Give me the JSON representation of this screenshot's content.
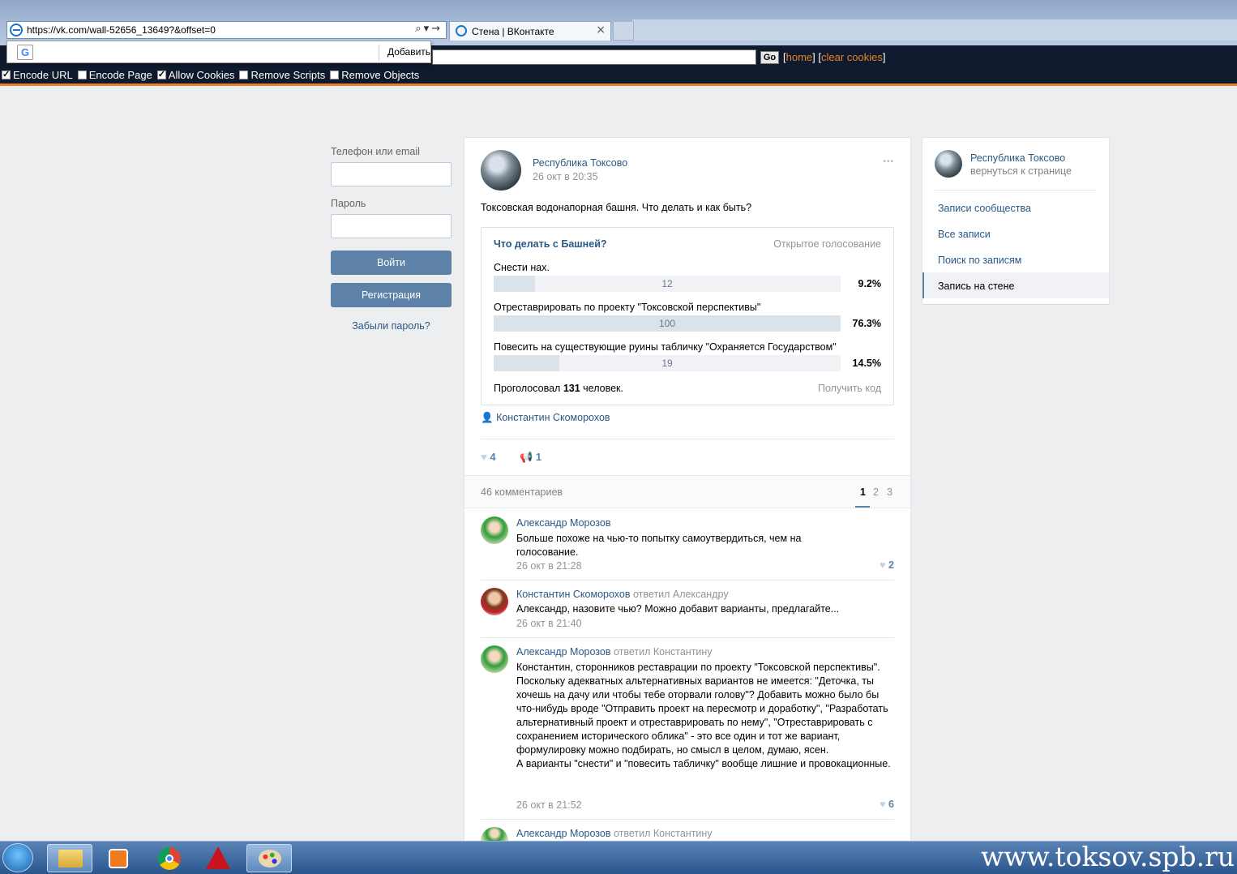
{
  "browser": {
    "url": "https://vk.com/wall-52656_13649?&offset=0",
    "tab_title": "Стена | ВКонтакте",
    "tab_close": "×",
    "dropdown_add": "Добавить",
    "google_glyph": "G"
  },
  "proxy": {
    "go_label": "Go",
    "home_link": "home",
    "clear_cookies_link": "clear cookies",
    "options": [
      {
        "label": "Encode URL",
        "checked": true
      },
      {
        "label": "Encode Page",
        "checked": false
      },
      {
        "label": "Allow Cookies",
        "checked": true
      },
      {
        "label": "Remove Scripts",
        "checked": false
      },
      {
        "label": "Remove Objects",
        "checked": false
      }
    ]
  },
  "login": {
    "phone_label": "Телефон или email",
    "password_label": "Пароль",
    "login_button": "Войти",
    "register_button": "Регистрация",
    "forgot_link": "Забыли пароль?"
  },
  "post": {
    "author": "Республика Токсово",
    "date": "26 окт в 20:35",
    "more": "•••",
    "text": "Токсовская водонапорная башня. Что делать и как быть?",
    "signer": "Константин Скоморохов",
    "likes": "4",
    "shares": "1",
    "comments_count": "46 комментариев",
    "pages": [
      "1",
      "2",
      "3"
    ]
  },
  "poll": {
    "title": "Что делать с Башней?",
    "type": "Открытое голосование",
    "options": [
      {
        "label": "Снести нах.",
        "votes": "12",
        "percent": "9.2%",
        "fraction": 0.12
      },
      {
        "label": "Отреставрировать по проекту \"Токсовской перспективы\"",
        "votes": "100",
        "percent": "76.3%",
        "fraction": 1.0
      },
      {
        "label": "Повесить на существующие руины табличку \"Охраняется Государством\"",
        "votes": "19",
        "percent": "14.5%",
        "fraction": 0.19
      }
    ],
    "total_prefix": "Проголосовал ",
    "total_count": "131",
    "total_suffix": " человек.",
    "get_code": "Получить код"
  },
  "comments": [
    {
      "author": "Александр Морозов",
      "reply_to": "",
      "text": "Больше похоже на чью-то попытку самоутвердиться, чем на голосование.",
      "date": "26 окт в 21:28",
      "likes": "2"
    },
    {
      "author": "Константин Скоморохов",
      "reply_to": "ответил Александру",
      "text": "Александр, назовите чью? Можно добавит варианты, предлагайте...",
      "date": "26 окт в 21:40",
      "likes": ""
    },
    {
      "author": "Александр Морозов",
      "reply_to": "ответил Константину",
      "text": "Константин, сторонников реставрации по проекту \"Токсовской перспективы\". Поскольку адекватных альтернативных вариантов не имеется: \"Деточка, ты хочешь на дачу или чтобы тебе оторвали голову\"? Добавить можно было бы что-нибудь вроде \"Отправить проект на пересмотр и доработку\", \"Разработать альтернативный проект и отреставрировать по нему\", \"Отреставрировать с сохранением исторического облика\" - это все один и тот же вариант, формулировку можно подбирать, но смысл в целом, думаю, ясен.\nА варианты \"снести\" и \"повесить табличку\" вообще лишние и провокационные.",
      "date": "26 окт в 21:52",
      "likes": "6"
    },
    {
      "author": "Александр Морозов",
      "reply_to": "ответил Константину",
      "text": "",
      "date": "",
      "likes": ""
    }
  ],
  "sidebar": {
    "group_name": "Республика Токсово",
    "back_link": "вернуться к странице",
    "items": [
      {
        "label": "Записи сообщества",
        "active": false
      },
      {
        "label": "Все записи",
        "active": false
      },
      {
        "label": "Поиск по записям",
        "active": false
      },
      {
        "label": "Запись на стене",
        "active": true
      }
    ]
  },
  "watermark": "www.toksov.spb.ru",
  "colors": {
    "vk_link": "#2a5885",
    "vk_button": "#5e81a8",
    "proxy_accent": "#e8822a",
    "page_bg": "#edeef0"
  }
}
